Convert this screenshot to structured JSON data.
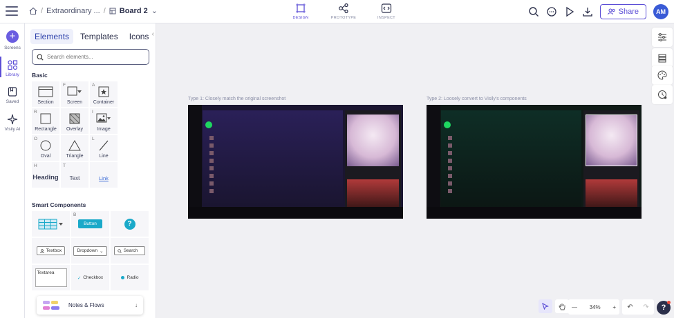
{
  "header": {
    "breadcrumb": [
      "Extraordinary ...",
      "Board 2"
    ],
    "modes": [
      {
        "label": "DESIGN",
        "active": true
      },
      {
        "label": "PROTOTYPE",
        "active": false
      },
      {
        "label": "INSPECT",
        "active": false
      }
    ],
    "share_label": "Share",
    "avatar_initials": "AM"
  },
  "rail": {
    "items": [
      "Screens",
      "Library",
      "Saved",
      "Visily AI"
    ]
  },
  "panel": {
    "tabs": [
      "Elements",
      "Templates",
      "Icons"
    ],
    "search_placeholder": "Search elements...",
    "basic_title": "Basic",
    "basic": [
      {
        "key": "",
        "label": "Section"
      },
      {
        "key": "F",
        "label": "Screen"
      },
      {
        "key": "A",
        "label": "Container"
      },
      {
        "key": "",
        "label": ""
      },
      {
        "key": "R",
        "label": "Rectangle"
      },
      {
        "key": "",
        "label": "Overlay"
      },
      {
        "key": "I",
        "label": "Image"
      },
      {
        "key": "",
        "label": ""
      },
      {
        "key": "O",
        "label": "Oval"
      },
      {
        "key": "",
        "label": "Triangle"
      },
      {
        "key": "L",
        "label": "Line"
      },
      {
        "key": "",
        "label": ""
      },
      {
        "key": "H",
        "label": "Heading"
      },
      {
        "key": "T",
        "label": "Text"
      },
      {
        "key": "",
        "label": "Link"
      }
    ],
    "smart_title": "Smart Components",
    "smart": {
      "button_key": "B",
      "button_label": "Button",
      "help_glyph": "?",
      "textbox": "Textbox",
      "dropdown": "Dropdown",
      "search": "Search",
      "textarea": "Textarea",
      "checkbox": "Checkbox",
      "radio": "Radio"
    },
    "notes_label": "Notes & Flows"
  },
  "canvas": {
    "frame1_label": "Type 1: Closely match the original screenshot",
    "frame2_label": "Type 2: Loosely convert to Visily's components"
  },
  "bottom": {
    "zoom": "34%"
  },
  "colors": {
    "accent": "#5b4dd6",
    "cyan": "#1aa9c9",
    "spotify_green": "#1ed760"
  }
}
